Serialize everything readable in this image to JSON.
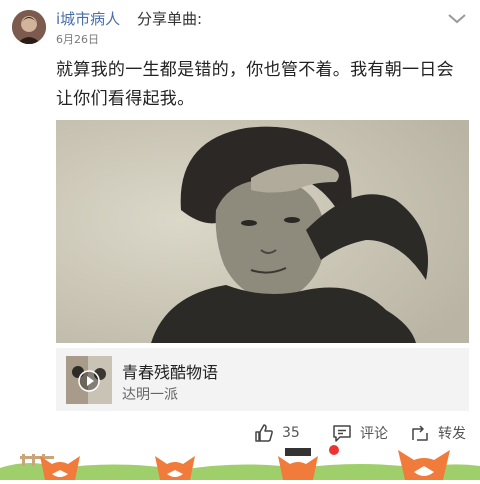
{
  "post": {
    "username": "i城市病人",
    "share_label": "分享单曲:",
    "date": "6月26日",
    "text": "就算我的一生都是错的，你也管不着。我有朝一日会让你们看得起我。"
  },
  "music": {
    "title": "青春残酷物语",
    "artist": "达明一派"
  },
  "actions": {
    "like_count": "35",
    "comment_label": "评论",
    "repost_label": "转发"
  },
  "icons": [
    "avatar",
    "chevron-down-icon",
    "play-icon",
    "like-icon",
    "comment-icon",
    "repost-icon",
    "fox-icon"
  ],
  "colors": {
    "username": "#4a6ea8",
    "music_card_bg": "#f3f3f3",
    "footer_accent": "#f07b3a"
  }
}
